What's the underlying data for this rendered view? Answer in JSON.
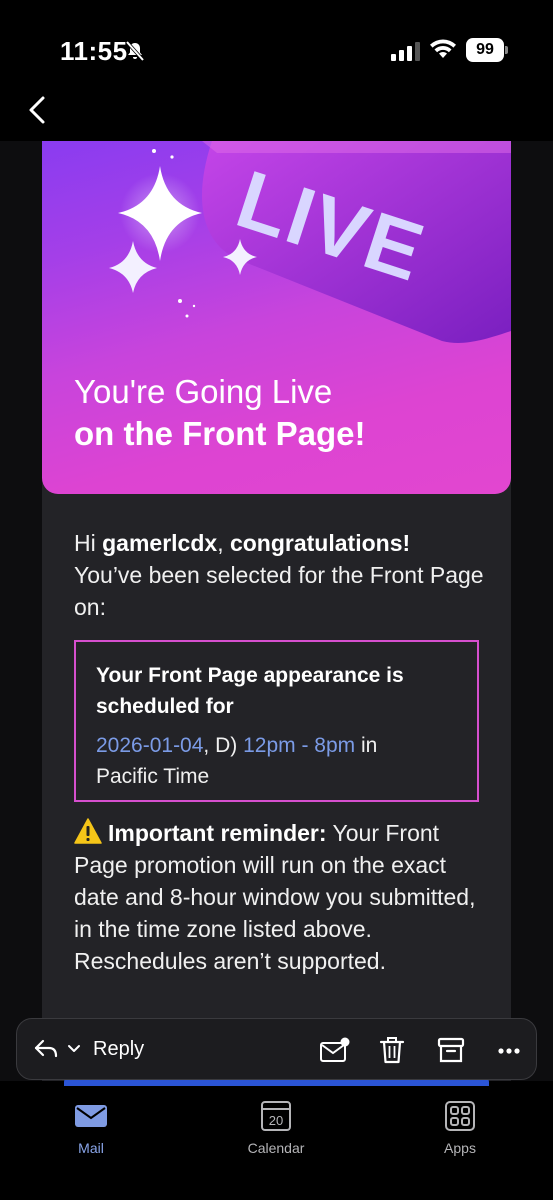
{
  "status_bar": {
    "time": "11:55",
    "battery": "99"
  },
  "email": {
    "hero": {
      "line1": "You're Going Live",
      "line2": "on the Front Page!",
      "badge_text": "LIVE"
    },
    "greeting": {
      "hi": "Hi ",
      "username": "gamerlcdx",
      "comma": ", ",
      "congrats": "congratulations!",
      "body": "You’ve been selected for the Front Page on:"
    },
    "schedule": {
      "heading": "Your Front Page appearance is scheduled for",
      "date": "2026-01-04",
      "sep": ", D) ",
      "time_range": "12pm - 8pm",
      "in": " in",
      "timezone": "Pacific Time"
    },
    "reminder": {
      "label": "Important reminder:",
      "body": " Your Front Page promotion will run on the exact date and 8-hour window you submitted, in the time zone listed above. Reschedules aren’t supported."
    }
  },
  "reply_bar": {
    "reply_label": "Reply"
  },
  "tab_bar": {
    "tabs": [
      {
        "label": "Mail"
      },
      {
        "label": "Calendar",
        "day": "20"
      },
      {
        "label": "Apps"
      }
    ]
  },
  "colors": {
    "accent": "#8aa6ea",
    "link": "#7b9be6",
    "hero_pink": "#e246d0",
    "hero_purple": "#8a3cf0",
    "box_border": "#d64fce"
  }
}
